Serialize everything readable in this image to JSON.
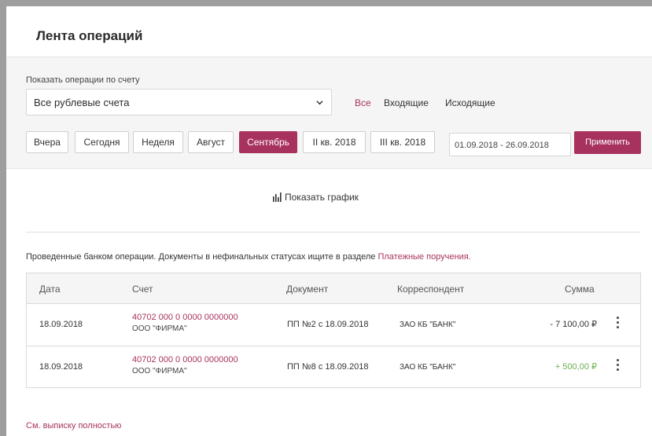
{
  "page": {
    "title": "Лента операций"
  },
  "filters": {
    "account_label": "Показать операции по счету",
    "account_value": "Все рублевые счета",
    "direction": [
      "Все",
      "Входящие",
      "Исходящие"
    ],
    "periods": [
      "Вчера",
      "Сегодня",
      "Неделя",
      "Август",
      "Сентябрь",
      "II кв. 2018",
      "III кв. 2018"
    ],
    "active_period": "Сентябрь",
    "date_range": "01.09.2018 - 26.09.2018",
    "apply_label": "Применить"
  },
  "chart_toggle": {
    "label": "Показать график"
  },
  "notice": {
    "text": "Проведенные банком операции. Документы в нефинальных статусах ищите в разделе ",
    "link": "Платежные поручения",
    "suffix": "."
  },
  "table": {
    "headers": {
      "date": "Дата",
      "account": "Счет",
      "document": "Документ",
      "correspondent": "Корреспондент",
      "amount": "Сумма"
    },
    "rows": [
      {
        "date": "18.09.2018",
        "account_number": "40702 000 0 0000 0000000",
        "account_name": "ООО \"ФИРМА\"",
        "document": "ПП №2 с 18.09.2018",
        "correspondent": "ЗАО КБ \"БАНК\"",
        "amount": "- 7 100,00 ₽"
      },
      {
        "date": "18.09.2018",
        "account_number": "40702 000 0 0000 0000000",
        "account_name": "ООО \"ФИРМА\"",
        "document": "ПП №8 с 18.09.2018",
        "correspondent": "ЗАО КБ \"БАНК\"",
        "amount": "+ 500,00 ₽"
      }
    ]
  },
  "footer": {
    "full_statement_link": "См. выписку полностью"
  },
  "colors": {
    "accent": "#a8325e",
    "income": "#6ab04c"
  }
}
